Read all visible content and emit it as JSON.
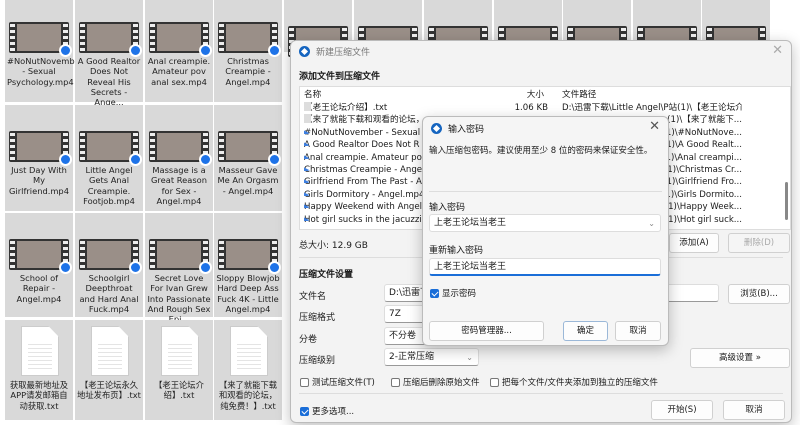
{
  "explorer": {
    "tiles": [
      {
        "label": "#NoNutNovember - Sexual Psychology.mp4",
        "type": "video"
      },
      {
        "label": "A Good Realtor Does Not Reveal His Secrets - Ange...",
        "type": "video"
      },
      {
        "label": "Anal creampie. Amateur pov anal sex.mp4",
        "type": "video"
      },
      {
        "label": "Christmas Creampie - Angel.mp4",
        "type": "video"
      },
      {
        "label": "Just Day With My Girlfriend.mp4",
        "type": "video"
      },
      {
        "label": "Little Angel Gets Anal Creampie. Footjob.mp4",
        "type": "video"
      },
      {
        "label": "Massage is a Great Reason for Sex - Angel.mp4",
        "type": "video"
      },
      {
        "label": "Masseur Gave Me An Orgasm - Angel.mp4",
        "type": "video"
      },
      {
        "label": "School of Repair - Angel.mp4",
        "type": "video"
      },
      {
        "label": "Schoolgirl Deepthroat and Hard Anal Fuck.mp4",
        "type": "video"
      },
      {
        "label": "Secret Love For Ivan Grew Into Passionate And Rough Sex Epi...",
        "type": "video"
      },
      {
        "label": "Sloppy Blowjob Hard Deep Ass Fuck 4K - Little Angel.mp4",
        "type": "video"
      },
      {
        "label": "获取最新地址及APP请发邮箱自动获取.txt",
        "type": "text"
      },
      {
        "label": "【老王论坛永久地址发布页】.txt",
        "type": "text"
      },
      {
        "label": "【老王论坛介绍】.txt",
        "type": "text"
      },
      {
        "label": "【来了就能下载和观看的论坛，纯免费！】.txt",
        "type": "text"
      }
    ]
  },
  "archive_dialog": {
    "title": "新建压缩文件",
    "section_add": "添加文件到压缩文件",
    "columns": {
      "name": "名称",
      "size": "大小",
      "path": "文件路径"
    },
    "rows": [
      {
        "name": "【老王论坛介绍】.txt",
        "size": "1.06 KB",
        "path": "D:\\迅雷下载\\Little Angel\\P站(1)\\【老王论坛介...",
        "icon": "text-file"
      },
      {
        "name": "【来了就能下载和观看的论坛，",
        "size": "",
        "path": "(1)\\【来了就能下...",
        "icon": "text-file"
      },
      {
        "name": "#NoNutNovember - Sexual",
        "size": "",
        "path": "(1)\\#NoNutNove...",
        "icon": "video-file"
      },
      {
        "name": "A Good Realtor Does Not R",
        "size": "",
        "path": "(1)\\A Good Realt...",
        "icon": "video-file"
      },
      {
        "name": "Anal creampie. Amateur po",
        "size": "",
        "path": "(1)\\Anal creampi...",
        "icon": "video-file"
      },
      {
        "name": "Christmas Creampie - Ange",
        "size": "",
        "path": "(1)\\Christmas Cr...",
        "icon": "video-file"
      },
      {
        "name": "Girlfriend From The Past - A",
        "size": "",
        "path": "(1)\\Girlfriend Fro...",
        "icon": "video-file"
      },
      {
        "name": "Girls Dormitory - Angel.mp4",
        "size": "",
        "path": "(1)\\Girls Dormito...",
        "icon": "video-file"
      },
      {
        "name": "Happy Weekend with Angel",
        "size": "",
        "path": "(1)\\Happy Week...",
        "icon": "video-file"
      },
      {
        "name": "Hot girl sucks in the jacuzzi",
        "size": "",
        "path": "(1)\\Hot girl suck...",
        "icon": "video-file"
      }
    ],
    "total_size": "总大小: 12.9 GB",
    "add_button": "添加(A)",
    "delete_button": "删除(D)",
    "section_settings": "压缩文件设置",
    "filename_label": "文件名",
    "filename_value": "D:\\迅雷下",
    "browse_button": "浏览(B)...",
    "format_label": "压缩格式",
    "format_value": "7Z",
    "volume_label": "分卷",
    "volume_value": "不分卷",
    "level_label": "压缩级别",
    "level_value": "2-正常压缩",
    "advanced_button": "高级设置 »",
    "opt_test": "测试压缩文件(T)",
    "opt_test_checked": false,
    "opt_delete": "压缩后删除原始文件",
    "opt_delete_checked": false,
    "opt_separate": "把每个文件/文件夹添加到独立的压缩文件",
    "opt_separate_checked": false,
    "more_options": "更多选项...",
    "more_options_checked": true,
    "start_button": "开始(S)",
    "cancel_button": "取消"
  },
  "password_dialog": {
    "title": "输入密码",
    "description": "输入压缩包密码。建议使用至少 8 位的密码来保证安全性。",
    "password_label": "输入密码",
    "password_value": "上老王论坛当老王",
    "confirm_label": "重新输入密码",
    "confirm_value": "上老王论坛当老王",
    "show_password": "显示密码",
    "show_password_checked": true,
    "manager_button": "密码管理器...",
    "ok_button": "确定",
    "cancel_button": "取消"
  },
  "colors": {
    "accent": "#1a6ed8",
    "tile_bg": "#d9d9d9",
    "dialog_bg": "#f3f3f3"
  }
}
